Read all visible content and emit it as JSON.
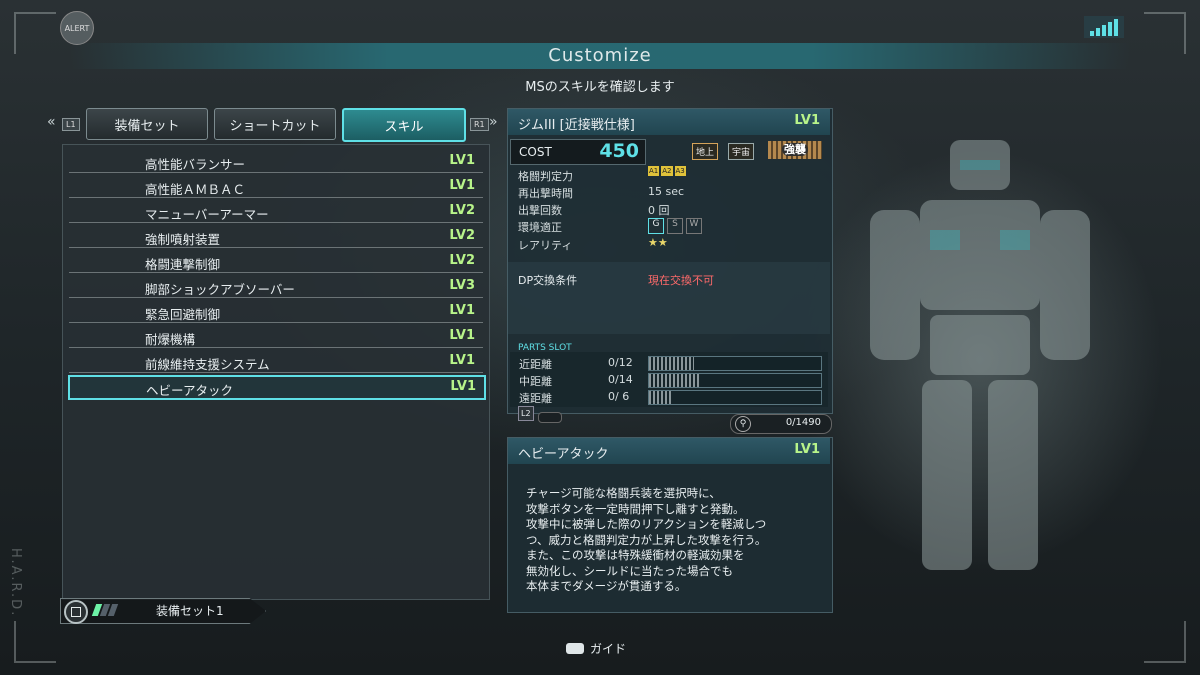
{
  "header": {
    "alert_label": "ALERT",
    "title": "Customize",
    "subtitle": "MSのスキルを確認します",
    "side_text": "H.A.R.D."
  },
  "tabs": {
    "left_button": "L1",
    "right_button": "R1",
    "items": [
      {
        "label": "装備セット",
        "active": false
      },
      {
        "label": "ショートカット",
        "active": false
      },
      {
        "label": "スキル",
        "active": true
      }
    ]
  },
  "skills": [
    {
      "name": "高性能バランサー",
      "lv": "LV1"
    },
    {
      "name": "高性能ＡＭＢＡＣ",
      "lv": "LV1"
    },
    {
      "name": "マニューバーアーマー",
      "lv": "LV2"
    },
    {
      "name": "強制噴射装置",
      "lv": "LV2"
    },
    {
      "name": "格闘連撃制御",
      "lv": "LV2"
    },
    {
      "name": "脚部ショックアブソーバー",
      "lv": "LV3"
    },
    {
      "name": "緊急回避制御",
      "lv": "LV1"
    },
    {
      "name": "耐爆機構",
      "lv": "LV1"
    },
    {
      "name": "前線維持支援システム",
      "lv": "LV1"
    },
    {
      "name": "ヘビーアタック",
      "lv": "LV1",
      "selected": true
    }
  ],
  "equip_set": {
    "label": "装備セット1",
    "gauge_filled": 1,
    "gauge_total": 3
  },
  "ms": {
    "name": "ジムIII [近接戦仕様]",
    "lv": "LV1",
    "cost_label": "COST",
    "cost": "450",
    "terrain": [
      "地上",
      "宇宙"
    ],
    "badge": "強襲",
    "stats": [
      {
        "label": "格闘判定力",
        "value": ""
      },
      {
        "label": "再出撃時間",
        "value": "15 sec"
      },
      {
        "label": "出撃回数",
        "value": "0 回"
      },
      {
        "label": "環境適正",
        "value": ""
      },
      {
        "label": "レアリティ",
        "value": "★★"
      }
    ],
    "melee_ranks": [
      "A1",
      "A2",
      "A3"
    ],
    "env": [
      "G",
      "S",
      "W"
    ],
    "dp_label": "DP交換条件",
    "dp_value": "現在交換不可",
    "parts_slot_title": "PARTS SLOT",
    "slots": [
      {
        "label": "近距離",
        "value": "0/12",
        "max": 12
      },
      {
        "label": "中距離",
        "value": "0/14",
        "max": 14
      },
      {
        "label": "遠距離",
        "value": "0/ 6",
        "max": 6
      }
    ],
    "l2_label": "L2",
    "parts_total": "0/1490"
  },
  "skill_detail": {
    "name": "ヘビーアタック",
    "lv": "LV1",
    "lines": [
      "チャージ可能な格闘兵装を選択時に、",
      "攻撃ボタンを一定時間押下し離すと発動。",
      "攻撃中に被弾した際のリアクションを軽減しつ",
      "つ、威力と格闘判定力が上昇した攻撃を行う。",
      "また、この攻撃は特殊緩衝材の軽減効果を",
      "無効化し、シールドに当たった場合でも",
      "本体までダメージが貫通する。"
    ]
  },
  "footer": {
    "guide_label": "ガイド"
  },
  "colors": {
    "accent": "#5fe0e6",
    "level": "#b8f48a",
    "warning": "#ff6a6a"
  }
}
